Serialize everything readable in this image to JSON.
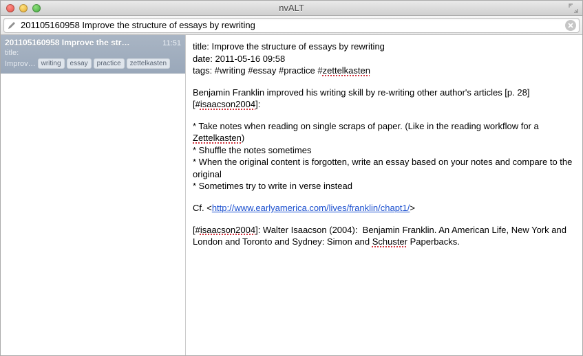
{
  "window": {
    "title": "nvALT"
  },
  "search": {
    "value": "201105160958 Improve the structure of essays by rewriting"
  },
  "sidebar": {
    "items": [
      {
        "title": "201105160958 Improve the str…",
        "time": "11:51",
        "subtitle": "title:",
        "preview": "Improv…",
        "tags": [
          "writing",
          "essay",
          "practice",
          "zettelkasten"
        ]
      }
    ]
  },
  "editor": {
    "meta": {
      "title_label": "title:",
      "title_value": "Improve the structure of essays by rewriting",
      "date_label": "date:",
      "date_value": "2011-05-16 09:58",
      "tags_label": "tags:",
      "tags_value": "#writing #essay #practice #zettelkasten",
      "tags_flag": "zettelkasten"
    },
    "intro": {
      "pre": "Benjamin Franklin improved his writing skill by re-writing other author's articles [p. 28][#",
      "ref": "isaacson2004",
      "post": "]:"
    },
    "bullets": {
      "b1a": "* Take notes when reading on single scraps of paper. (Like in the reading workflow for a ",
      "b1b": "Zettelkasten",
      "b1c": ")",
      "b2": "* Shuffle the notes sometimes",
      "b3": "* When the original content is forgotten, write an essay based on your notes and compare to the original",
      "b4": "* Sometimes try to write in verse instead"
    },
    "cf": {
      "pre": "Cf. <",
      "url": "http://www.earlyamerica.com/lives/franklin/chapt1/",
      "post": ">"
    },
    "ref": {
      "preA": "[#",
      "key": "isaacson2004",
      "preB": "]: Walter Isaacson (2004):  Benjamin Franklin. An American Life, New York and London and Toronto and Sydney: Simon and ",
      "pub": "Schuster",
      "post": " Paperbacks."
    }
  }
}
